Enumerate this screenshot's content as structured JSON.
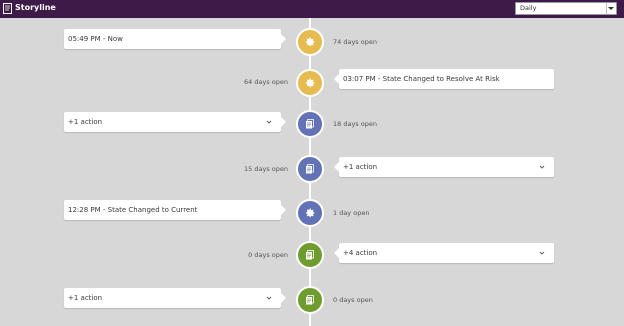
{
  "header": {
    "title": "Storyline",
    "filter_value": "Daily"
  },
  "timeline": [
    {
      "card_text": "05:49 PM - Now",
      "days_text": "74 days open",
      "icon": "gear-icon",
      "color": "#e6bb4f"
    },
    {
      "card_text": "03:07 PM - State Changed to Resolve At Risk",
      "days_text": "64 days open",
      "icon": "gear-icon",
      "color": "#e6bb4f"
    },
    {
      "card_text": "+1 action",
      "days_text": "18 days open",
      "icon": "document-stack-icon",
      "color": "#6272b4",
      "expandable": true
    },
    {
      "card_text": "+1 action",
      "days_text": "15 days open",
      "icon": "document-stack-icon",
      "color": "#6272b4",
      "expandable": true
    },
    {
      "card_text": "12:28 PM - State Changed to Current",
      "days_text": "1 day open",
      "icon": "gear-icon",
      "color": "#6272b4"
    },
    {
      "card_text": "+4 action",
      "days_text": "0 days open",
      "icon": "document-stack-icon",
      "color": "#6f9c2e",
      "expandable": true
    },
    {
      "card_text": "+1 action",
      "days_text": "0 days open",
      "icon": "document-stack-icon",
      "color": "#6f9c2e",
      "expandable": true
    }
  ]
}
